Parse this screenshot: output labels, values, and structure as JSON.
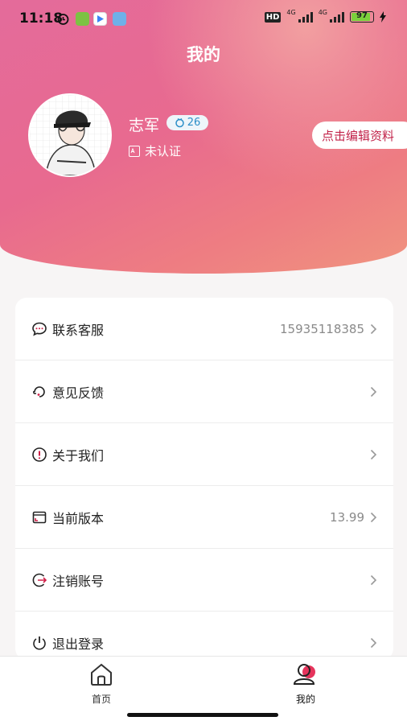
{
  "status_bar": {
    "time": "11:18",
    "network_1": "4G",
    "network_2": "4G",
    "hd_label": "HD",
    "battery": "97",
    "battery_level": 0.97
  },
  "header": {
    "title": "我的",
    "username": "志军",
    "level": "26",
    "verify_status": "未认证",
    "edit_button": "点击编辑资料"
  },
  "menu": {
    "items": [
      {
        "label": "联系客服",
        "value": "15935118385",
        "icon": "chat-bubble-icon"
      },
      {
        "label": "意见反馈",
        "value": "",
        "icon": "feedback-icon"
      },
      {
        "label": "关于我们",
        "value": "",
        "icon": "info-icon"
      },
      {
        "label": "当前版本",
        "value": "13.99",
        "icon": "version-icon"
      },
      {
        "label": "注销账号",
        "value": "",
        "icon": "logout-arrow-icon"
      },
      {
        "label": "退出登录",
        "value": "",
        "icon": "power-icon"
      }
    ]
  },
  "tabs": [
    {
      "label": "首页",
      "icon": "home-icon",
      "active": false
    },
    {
      "label": "我的",
      "icon": "profile-icon",
      "active": true
    }
  ],
  "colors": {
    "accent": "#c2234a",
    "header_gradient_start": "#e46b9b",
    "header_gradient_end": "#f0947f",
    "level_badge_text": "#2d8fc8"
  }
}
